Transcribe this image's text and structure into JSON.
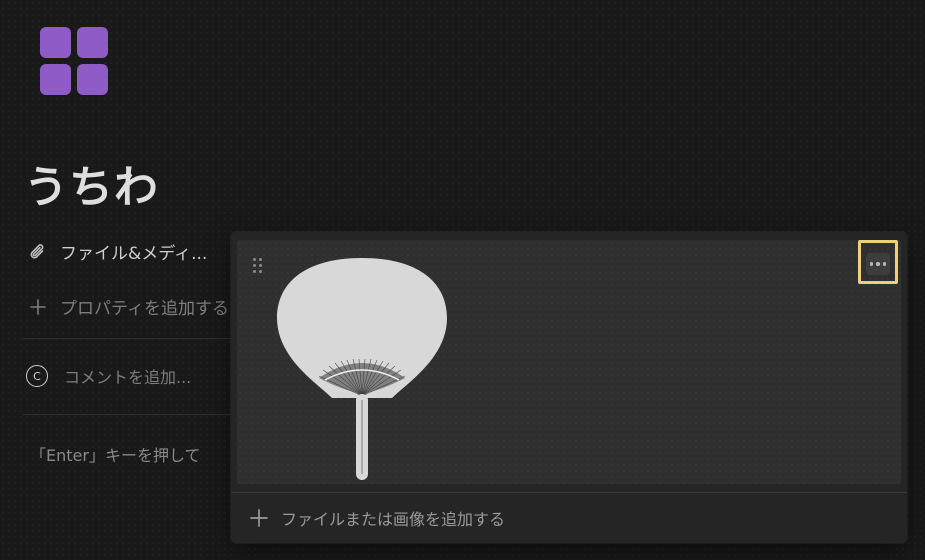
{
  "page": {
    "title": "うちわ",
    "icon": "grid-icon",
    "icon_color": "#8f5bc7"
  },
  "properties": {
    "files_label": "ファイル&メディ...",
    "files_icon": "paperclip-icon",
    "add_property_label": "プロパティを追加する",
    "add_property_icon": "plus-icon"
  },
  "comment": {
    "avatar_letter": "C",
    "placeholder": "コメントを追加..."
  },
  "hint_text": "「Enter」キーを押して",
  "popover": {
    "media_items": [
      {
        "image": "uchiwa-fan-image",
        "drag_icon": "drag-handle-icon"
      }
    ],
    "more_icon": "more-options-icon",
    "highlight_color": "#f0cf7a",
    "add_file_label": "ファイルまたは画像を追加する",
    "add_file_icon": "plus-icon"
  }
}
